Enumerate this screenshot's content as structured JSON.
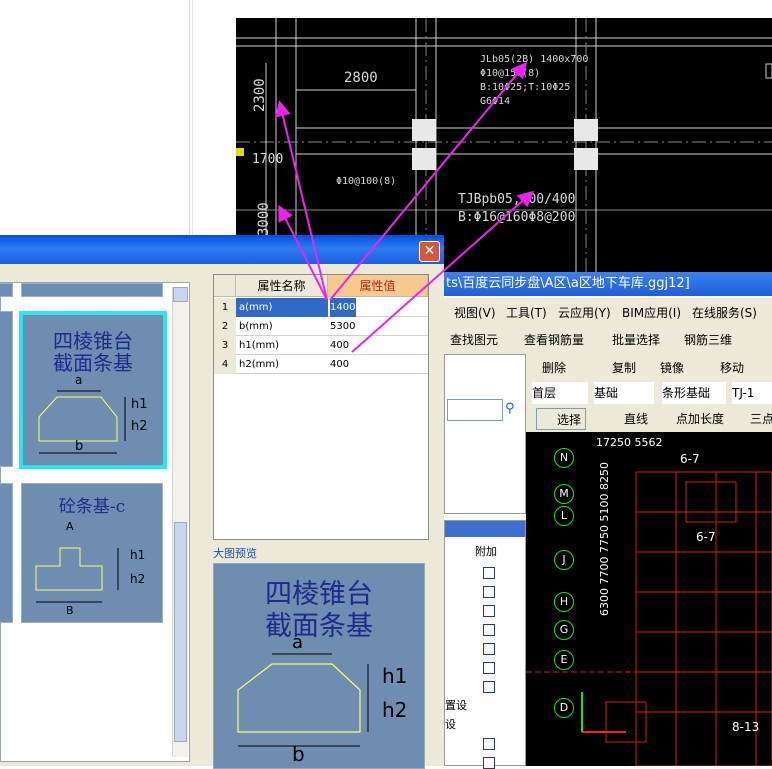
{
  "cad_top": {
    "dims": [
      "2800",
      "2300",
      "1700",
      "3000"
    ],
    "beam_label_1": "JLb05(2B) 1400x700",
    "beam_label_2": "Φ10@150(8)",
    "beam_label_3": "B:10Φ25;T:10Φ25",
    "beam_label_4": "G6Φ14",
    "stirrup_label": "Φ10@100(8)",
    "tjb_label_1": "TJBpb05,400/400",
    "tjb_label_2": "B:Φ16@160Φ8@200"
  },
  "dialog": {
    "close_label": "✕",
    "cards": [
      {
        "title_1": "四棱锥台",
        "title_2": "截面条基",
        "a": "a",
        "b": "b",
        "h1": "h1",
        "h2": "h2"
      },
      {
        "title_1": "砼条基-c",
        "a": "A",
        "b": "B",
        "h1": "h1",
        "h2": "h2"
      }
    ],
    "grid": {
      "col_name": "属性名称",
      "col_value": "属性值",
      "rows": [
        {
          "idx": "1",
          "name": "a(mm)",
          "value": "1400"
        },
        {
          "idx": "2",
          "name": "b(mm)",
          "value": "5300"
        },
        {
          "idx": "3",
          "name": "h1(mm)",
          "value": "400"
        },
        {
          "idx": "4",
          "name": "h2(mm)",
          "value": "400"
        }
      ]
    },
    "preview_label": "大图预览",
    "preview": {
      "title_1": "四棱锥台",
      "title_2": "截面条基",
      "a": "a",
      "b": "b",
      "h1": "h1",
      "h2": "h2"
    }
  },
  "app": {
    "title": "ts\\百度云同步盘\\A区\\a区地下车库.ggj12]",
    "menu": [
      "视图(V)",
      "工具(T)",
      "云应用(Y)",
      "BIM应用(I)",
      "在线服务(S)"
    ],
    "toolbar1": [
      "查找图元",
      "查看钢筋量",
      "批量选择",
      "钢筋三维"
    ],
    "toolbar2": [
      "删除",
      "复制",
      "镜像",
      "移动"
    ],
    "floor_select": "首层",
    "category_select": "基础",
    "type_select": "条形基础",
    "item_select": "TJ-1",
    "toolbar3": [
      "选择",
      "直线",
      "点加长度",
      "三点"
    ],
    "panel_header": "附加",
    "panel_rows": [
      "",
      "",
      "",
      "",
      "",
      "",
      "",
      "",
      "",
      "",
      "",
      ""
    ],
    "panel_texts": [
      "置设",
      "设"
    ],
    "axes": [
      "N",
      "M",
      "L",
      "J",
      "H",
      "G",
      "E",
      "D"
    ],
    "side_dims": "6300 7700 7750 5100 8250",
    "bottom_dims": "17250 5562",
    "grid_labels": [
      "6-7",
      "6-7",
      "8-13"
    ]
  },
  "colors": {
    "accent": "#ee22ee",
    "cad_bg": "#000000",
    "card_bg": "#6f8db0"
  }
}
